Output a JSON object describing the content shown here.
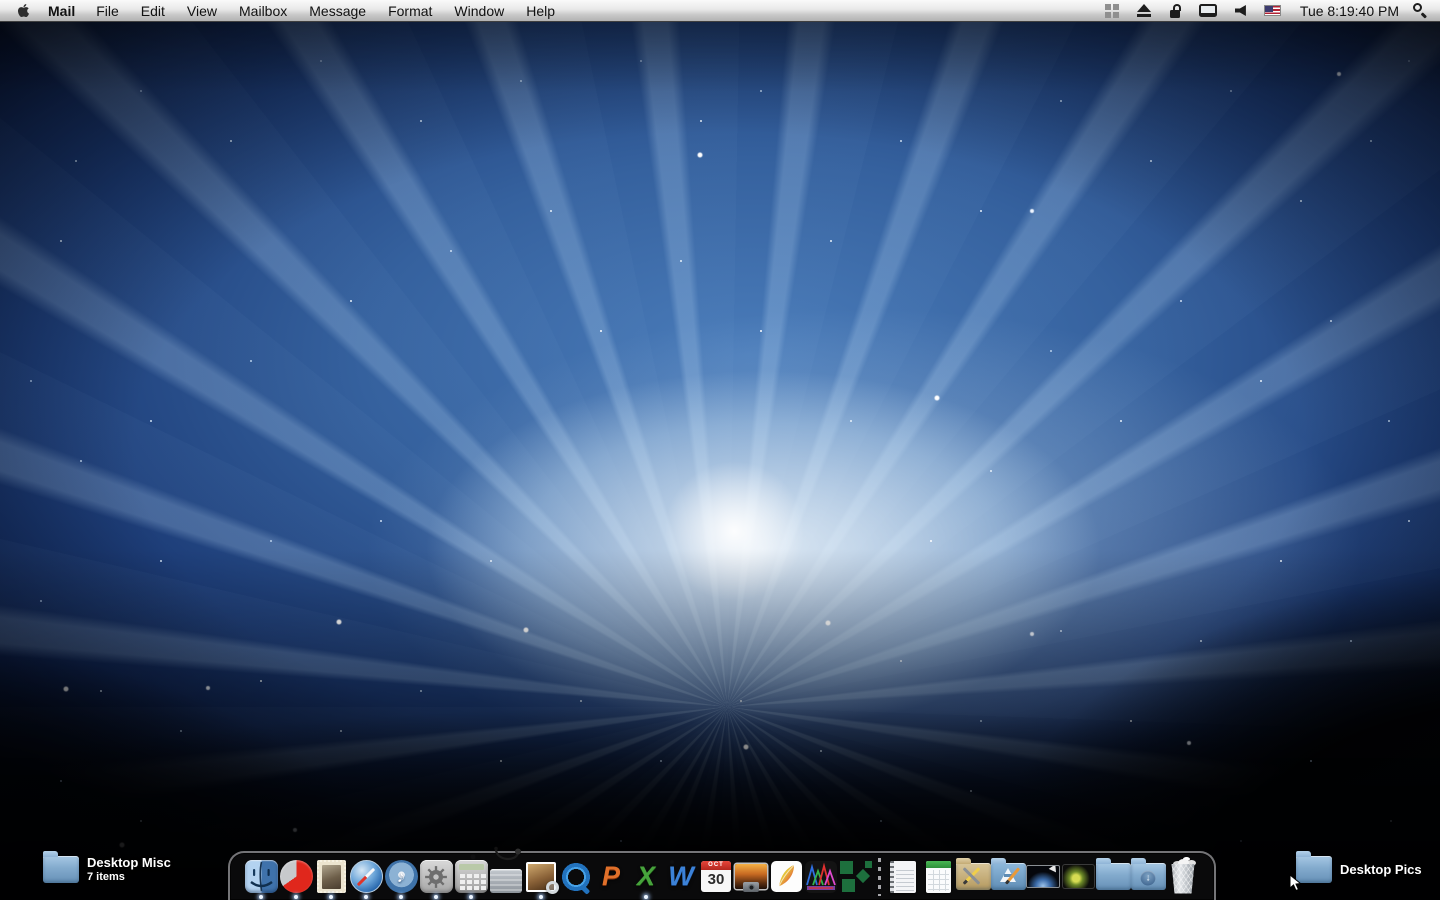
{
  "menubar": {
    "apple_menu_icon": "apple-logo",
    "app_menu": "Mail",
    "menus": [
      "File",
      "Edit",
      "View",
      "Mailbox",
      "Message",
      "Format",
      "Window",
      "Help"
    ],
    "status_icons": [
      "spaces-grid",
      "eject",
      "lock-open",
      "display",
      "volume",
      "input-source-us-flag"
    ],
    "clock": "Tue 8:19:40 PM",
    "spotlight_icon": "magnifier"
  },
  "desktop": {
    "left_folder": {
      "label": "Desktop Misc",
      "sublabel": "7 items"
    },
    "right_folder": {
      "label": "Desktop Pics"
    }
  },
  "dock": {
    "items": [
      {
        "icon": "finder",
        "running": true
      },
      {
        "icon": "pie-chart-app",
        "running": true
      },
      {
        "icon": "mail-stamp",
        "running": true
      },
      {
        "icon": "safari-compass",
        "running": true
      },
      {
        "icon": "itunes-disc",
        "running": true
      },
      {
        "icon": "system-preferences-gear",
        "running": true
      },
      {
        "icon": "calculator",
        "running": true
      },
      {
        "icon": "disk-utility-drive-stethoscope",
        "running": false
      },
      {
        "icon": "preview-photo-loupe",
        "running": true
      },
      {
        "icon": "quicktime-q",
        "running": false
      },
      {
        "icon": "powerpoint-p",
        "running": false
      },
      {
        "icon": "excel-x",
        "running": true
      },
      {
        "icon": "word-w",
        "running": false
      },
      {
        "icon": "ical-calendar",
        "running": false
      },
      {
        "icon": "iphoto-sunset-camera",
        "running": false
      },
      {
        "icon": "photoshop-feather",
        "running": false
      },
      {
        "icon": "dna-chromatogram-peaks-app",
        "running": false
      },
      {
        "icon": "green-diamonds-app",
        "running": false
      },
      {
        "icon": "notebook-document",
        "running": false
      },
      {
        "icon": "spreadsheet-document",
        "running": false
      },
      {
        "icon": "utilities-folder",
        "running": false
      },
      {
        "icon": "applications-folder",
        "running": false
      },
      {
        "icon": "aurora-picture",
        "running": false
      },
      {
        "icon": "photo-picture",
        "running": false
      },
      {
        "icon": "plain-folder",
        "running": false
      },
      {
        "icon": "downloads-folder",
        "running": false
      },
      {
        "icon": "trash-full",
        "running": false
      }
    ],
    "glyphs": {
      "itunes_note": "♪",
      "powerpoint_letter": "P",
      "excel_letter": "X",
      "word_letter": "W",
      "ical_month": "OCT",
      "ical_day": "30",
      "downloads_arrow": "↓"
    }
  }
}
